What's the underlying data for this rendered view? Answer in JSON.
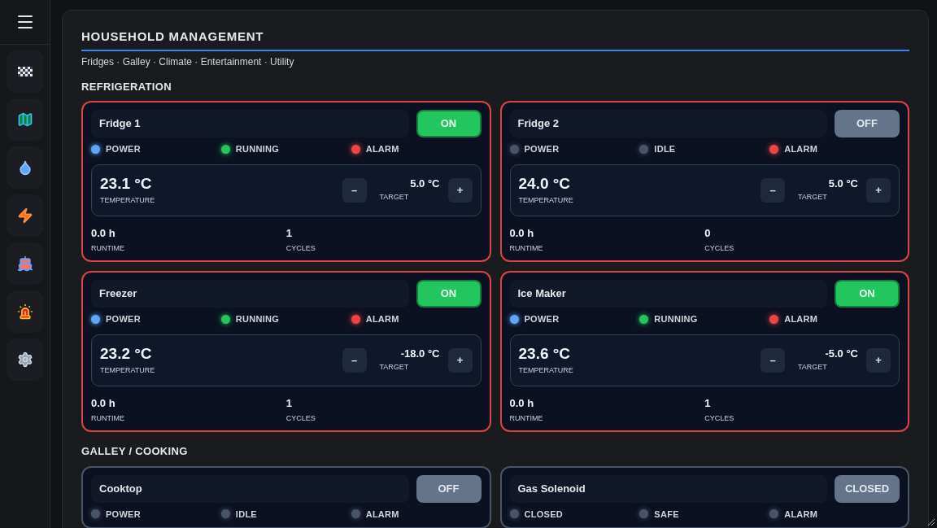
{
  "page": {
    "title": "HOUSEHOLD MANAGEMENT",
    "subtitle": "Fridges · Galley · Climate · Entertainment · Utility"
  },
  "sections": [
    {
      "title": "REFRIGERATION",
      "cards": [
        {
          "name": "Fridge 1",
          "alert": true,
          "toggle": {
            "label": "ON",
            "on": true
          },
          "indicators": [
            {
              "label": "POWER",
              "color": "#60a5fa"
            },
            {
              "label": "RUNNING",
              "color": "#22c55e"
            },
            {
              "label": "ALARM",
              "color": "#ef4444"
            }
          ],
          "temperature": {
            "value": "23.1 °C",
            "label": "TEMPERATURE"
          },
          "target": {
            "value": "5.0 °C",
            "label": "TARGET",
            "minus": "–",
            "plus": "+"
          },
          "stats": [
            {
              "value": "0.0 h",
              "label": "RUNTIME"
            },
            {
              "value": "1",
              "label": "CYCLES"
            }
          ]
        },
        {
          "name": "Fridge 2",
          "alert": true,
          "toggle": {
            "label": "OFF",
            "on": false
          },
          "indicators": [
            {
              "label": "POWER",
              "color": "#475569"
            },
            {
              "label": "IDLE",
              "color": "#475569"
            },
            {
              "label": "ALARM",
              "color": "#ef4444"
            }
          ],
          "temperature": {
            "value": "24.0 °C",
            "label": "TEMPERATURE"
          },
          "target": {
            "value": "5.0 °C",
            "label": "TARGET",
            "minus": "–",
            "plus": "+"
          },
          "stats": [
            {
              "value": "0.0 h",
              "label": "RUNTIME"
            },
            {
              "value": "0",
              "label": "CYCLES"
            }
          ]
        },
        {
          "name": "Freezer",
          "alert": true,
          "toggle": {
            "label": "ON",
            "on": true
          },
          "indicators": [
            {
              "label": "POWER",
              "color": "#60a5fa"
            },
            {
              "label": "RUNNING",
              "color": "#22c55e"
            },
            {
              "label": "ALARM",
              "color": "#ef4444"
            }
          ],
          "temperature": {
            "value": "23.2 °C",
            "label": "TEMPERATURE"
          },
          "target": {
            "value": "-18.0 °C",
            "label": "TARGET",
            "minus": "–",
            "plus": "+"
          },
          "stats": [
            {
              "value": "0.0 h",
              "label": "RUNTIME"
            },
            {
              "value": "1",
              "label": "CYCLES"
            }
          ]
        },
        {
          "name": "Ice Maker",
          "alert": true,
          "toggle": {
            "label": "ON",
            "on": true
          },
          "indicators": [
            {
              "label": "POWER",
              "color": "#60a5fa"
            },
            {
              "label": "RUNNING",
              "color": "#22c55e"
            },
            {
              "label": "ALARM",
              "color": "#ef4444"
            }
          ],
          "temperature": {
            "value": "23.6 °C",
            "label": "TEMPERATURE"
          },
          "target": {
            "value": "-5.0 °C",
            "label": "TARGET",
            "minus": "–",
            "plus": "+"
          },
          "stats": [
            {
              "value": "0.0 h",
              "label": "RUNTIME"
            },
            {
              "value": "1",
              "label": "CYCLES"
            }
          ]
        }
      ]
    },
    {
      "title": "GALLEY / COOKING",
      "cards": [
        {
          "name": "Cooktop",
          "alert": false,
          "toggle": {
            "label": "OFF",
            "on": false
          },
          "indicators": [
            {
              "label": "POWER",
              "color": "#475569"
            },
            {
              "label": "IDLE",
              "color": "#475569"
            },
            {
              "label": "ALARM",
              "color": "#475569"
            }
          ]
        },
        {
          "name": "Gas Solenoid",
          "alert": false,
          "toggle": {
            "label": "CLOSED",
            "on": false
          },
          "indicators": [
            {
              "label": "CLOSED",
              "color": "#475569"
            },
            {
              "label": "SAFE",
              "color": "#475569"
            },
            {
              "label": "ALARM",
              "color": "#475569"
            }
          ]
        }
      ]
    }
  ]
}
